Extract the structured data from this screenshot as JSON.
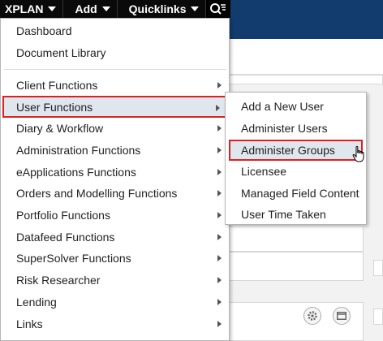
{
  "topnav": {
    "xplan": "XPLAN",
    "add": "Add",
    "quicklinks": "Quicklinks",
    "search_icon": "search-icon"
  },
  "menu": {
    "items": [
      {
        "label": "Dashboard",
        "submenu": false
      },
      {
        "label": "Document Library",
        "submenu": false
      },
      {
        "label": "Client Functions",
        "submenu": true
      },
      {
        "label": "User Functions",
        "submenu": true,
        "selected": true
      },
      {
        "label": "Diary & Workflow",
        "submenu": true
      },
      {
        "label": "Administration Functions",
        "submenu": true
      },
      {
        "label": "eApplications Functions",
        "submenu": true
      },
      {
        "label": "Orders and Modelling Functions",
        "submenu": true
      },
      {
        "label": "Portfolio Functions",
        "submenu": true
      },
      {
        "label": "Datafeed Functions",
        "submenu": true
      },
      {
        "label": "SuperSolver Functions",
        "submenu": true
      },
      {
        "label": "Risk Researcher",
        "submenu": true
      },
      {
        "label": "Lending",
        "submenu": true
      },
      {
        "label": "Links",
        "submenu": true
      }
    ]
  },
  "submenu": {
    "items": [
      {
        "label": "Add a New User"
      },
      {
        "label": "Administer Users"
      },
      {
        "label": "Administer Groups",
        "selected": true
      },
      {
        "label": "Licensee"
      },
      {
        "label": "Managed Field Content"
      },
      {
        "label": "User Time Taken"
      }
    ]
  },
  "colors": {
    "header_blue": "#123c6e",
    "highlight_border": "#e02020",
    "selected_bg": "#dfe6ee"
  }
}
